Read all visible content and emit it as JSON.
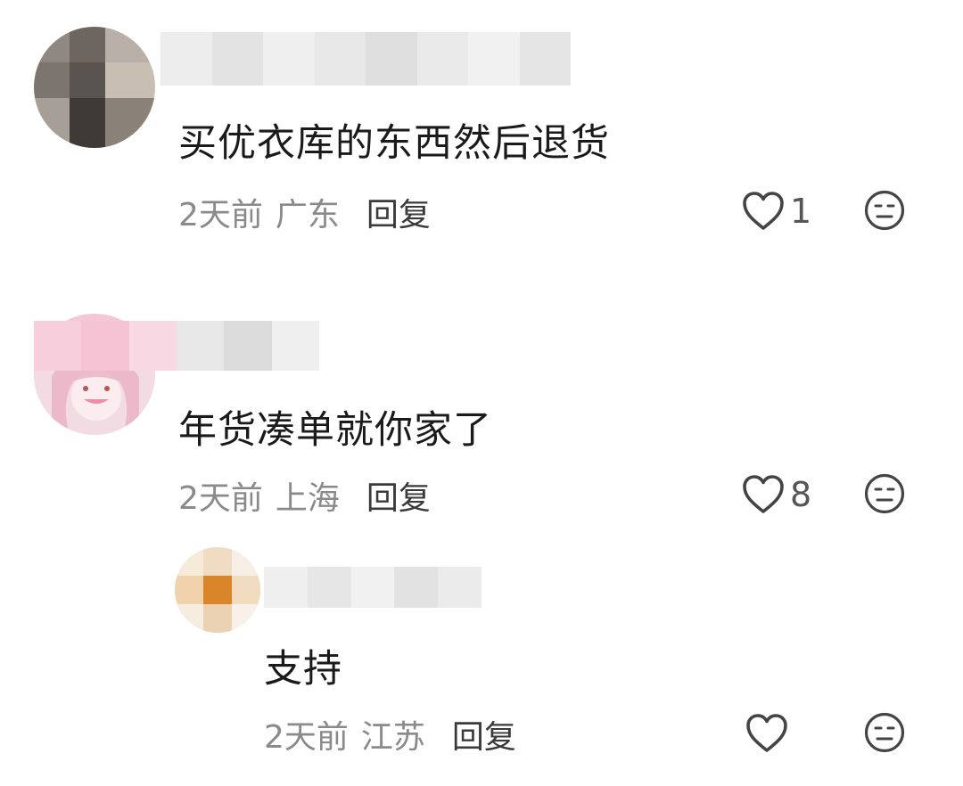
{
  "comments": [
    {
      "text": "买优衣库的东西然后退货",
      "time": "2天前",
      "location": "广东",
      "reply_label": "回复",
      "likes": "1"
    },
    {
      "text": "年货凑单就你家了",
      "time": "2天前",
      "location": "上海",
      "reply_label": "回复",
      "likes": "8"
    },
    {
      "text": "支持",
      "time": "2天前",
      "location": "江苏",
      "reply_label": "回复",
      "likes": ""
    }
  ],
  "icons": {
    "like": "heart-outline-icon",
    "dislike": "meh-face-icon"
  },
  "colors": {
    "text": "#1a1a1a",
    "meta": "#8a8a8a",
    "icon": "#444444"
  }
}
